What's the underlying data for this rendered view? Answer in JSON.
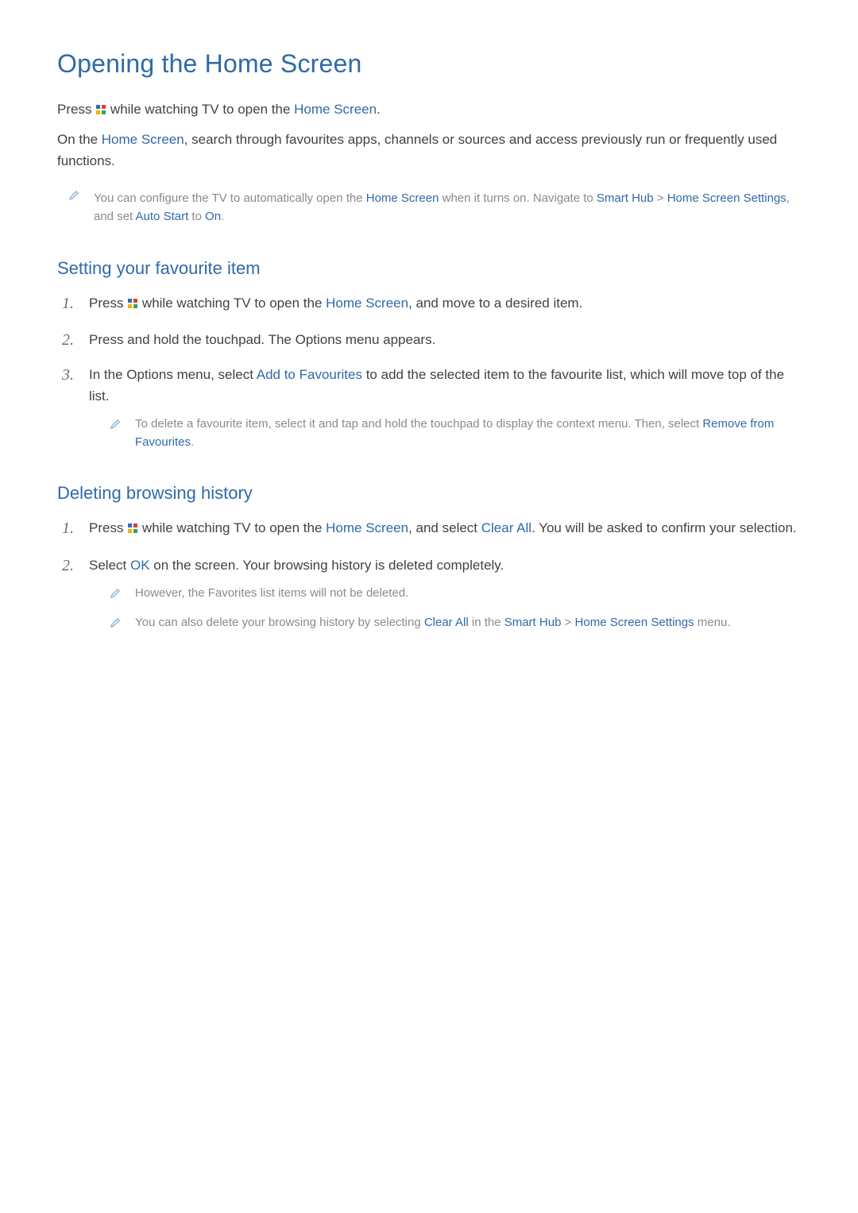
{
  "title": "Opening the Home Screen",
  "intro1_a": "Press ",
  "intro1_b": " while watching TV to open the ",
  "intro1_link": "Home Screen",
  "intro1_end": ".",
  "intro2_a": "On the ",
  "intro2_link": "Home Screen",
  "intro2_b": ", search through favourites apps, channels or sources and access previously run or frequently used functions.",
  "topnote_a": "You can configure the TV to automatically open the ",
  "topnote_l1": "Home Screen",
  "topnote_b": " when it turns on. Navigate to ",
  "topnote_l2": "Smart Hub",
  "topnote_gt": " > ",
  "topnote_l3": "Home Screen Settings",
  "topnote_c": ", and set ",
  "topnote_l4": "Auto Start",
  "topnote_d": " to ",
  "topnote_l5": "On",
  "topnote_end": ".",
  "section1_title": "Setting your favourite item",
  "s1_li1_a": "Press ",
  "s1_li1_b": " while watching TV to open the ",
  "s1_li1_link": "Home Screen",
  "s1_li1_c": ", and move to a desired item.",
  "s1_li2": "Press and hold the touchpad. The Options menu appears.",
  "s1_li3_a": "In the Options menu, select ",
  "s1_li3_link": "Add to Favourites",
  "s1_li3_b": " to add the selected item to the favourite list, which will move top of the list.",
  "s1_note_a": "To delete a favourite item, select it and tap and hold the touchpad to display the context menu. Then, select ",
  "s1_note_link": "Remove from Favourites",
  "s1_note_end": ".",
  "section2_title": "Deleting browsing history",
  "s2_li1_a": "Press ",
  "s2_li1_b": " while watching TV to open the ",
  "s2_li1_link1": "Home Screen",
  "s2_li1_c": ", and select ",
  "s2_li1_link2": "Clear All",
  "s2_li1_d": ". You will be asked to confirm your selection.",
  "s2_li2_a": "Select ",
  "s2_li2_link": "OK",
  "s2_li2_b": " on the screen. Your browsing history is deleted completely.",
  "s2_note1": "However, the Favorites list items will not be deleted.",
  "s2_note2_a": "You can also delete your browsing history by selecting ",
  "s2_note2_l1": "Clear All",
  "s2_note2_b": " in the ",
  "s2_note2_l2": "Smart Hub",
  "s2_note2_gt": " > ",
  "s2_note2_l3": "Home Screen Settings",
  "s2_note2_c": " menu."
}
